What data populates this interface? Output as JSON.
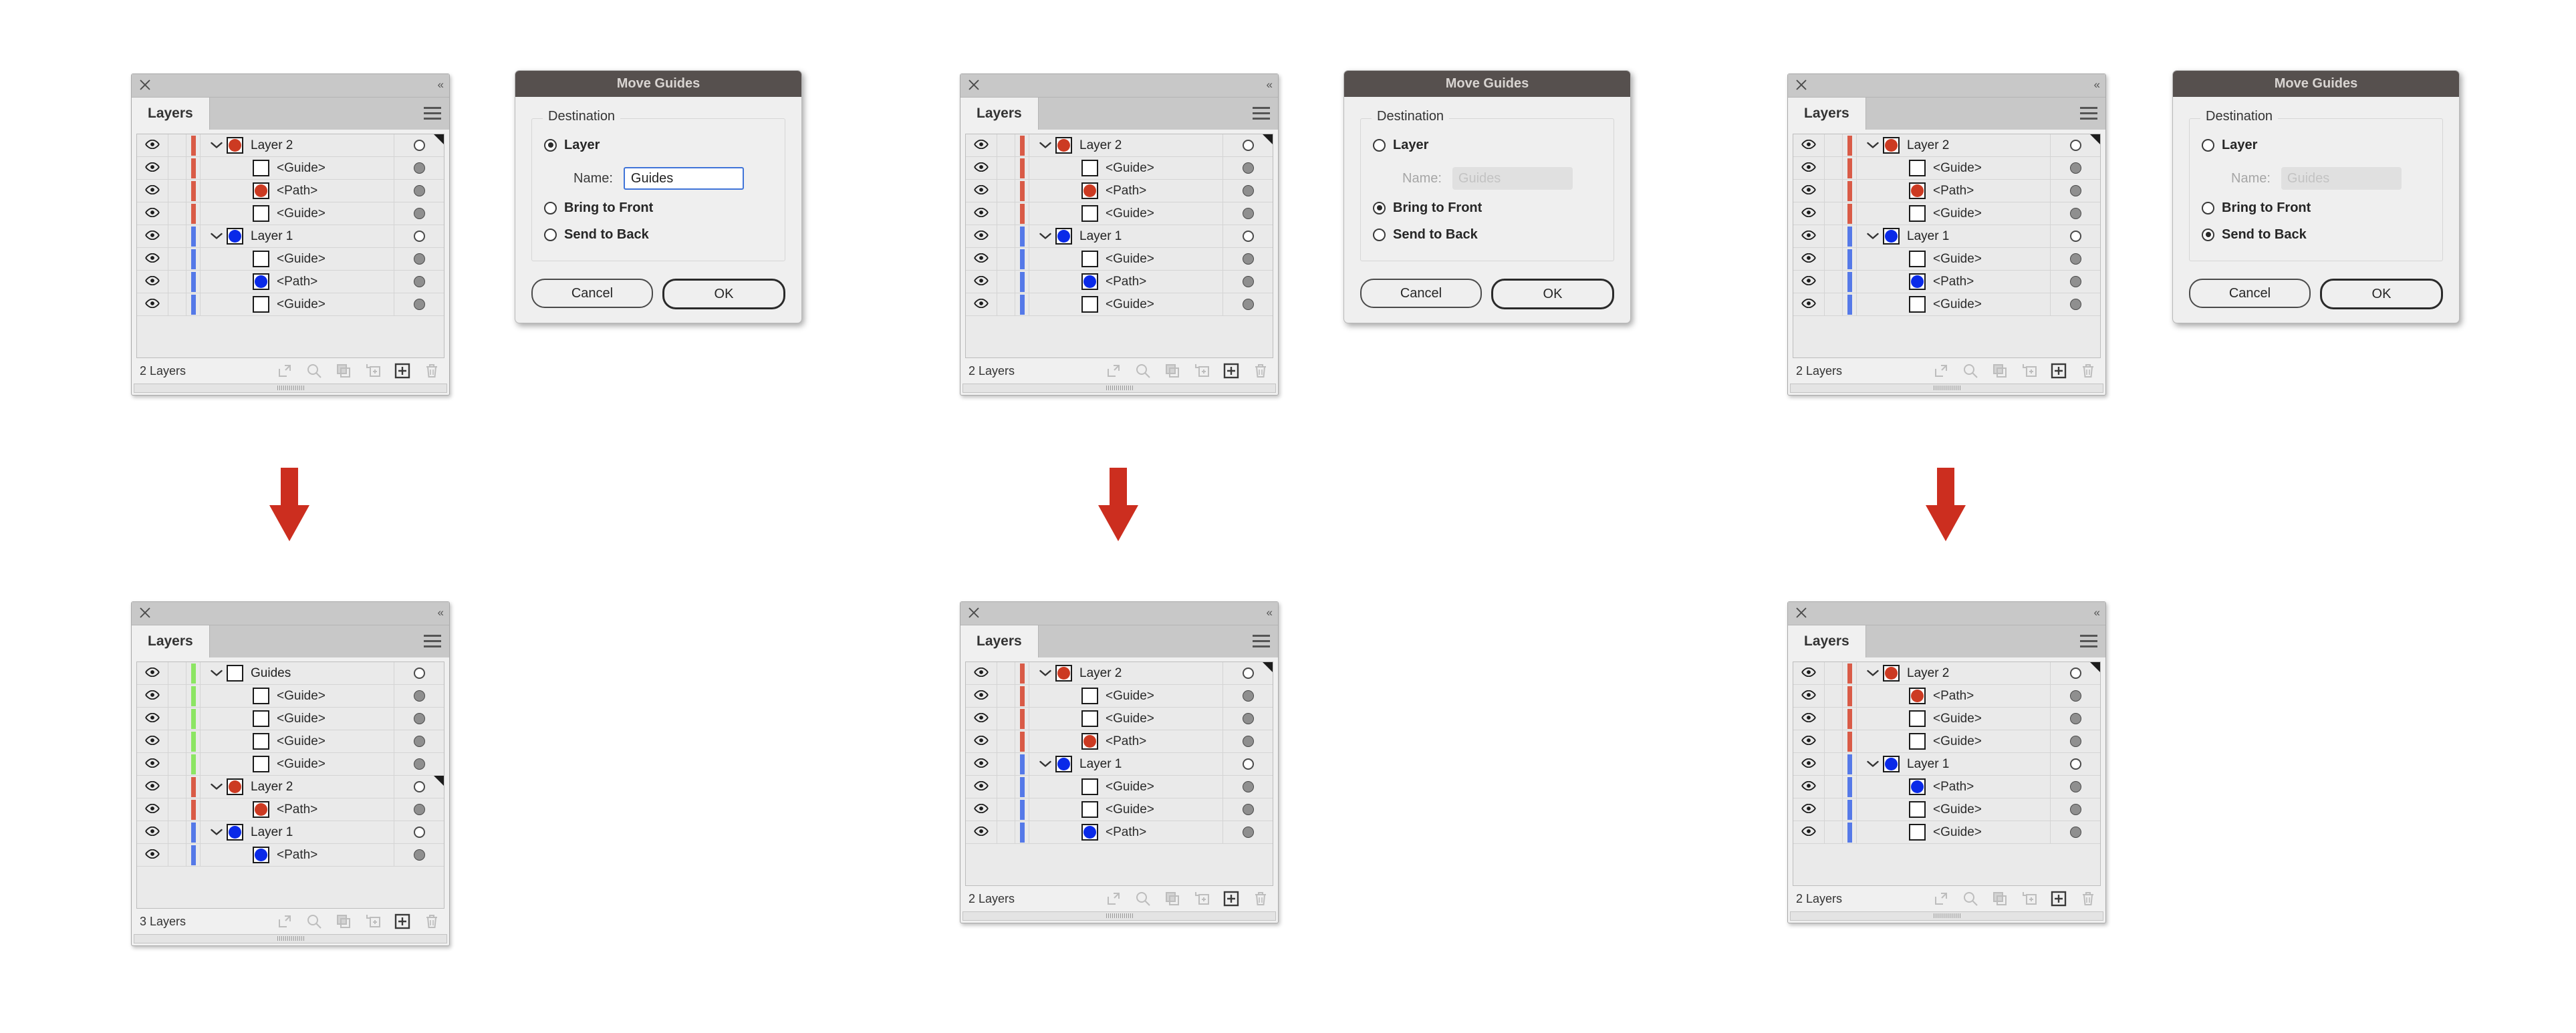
{
  "panel": {
    "tab_label": "Layers",
    "close_icon": "close-icon",
    "collapse_icon": "collapse-panel-icon",
    "menu_icon": "panel-menu-icon",
    "footer_icons": [
      "release-to-layers-icon",
      "locate-object-icon",
      "make-clipping-mask-icon",
      "create-new-sublayer-icon",
      "create-new-layer-icon",
      "delete-selection-icon"
    ]
  },
  "colors": {
    "red_layer": "#cc3a22",
    "blue_layer": "#0a2ae8",
    "red_bar": "#d95b47",
    "blue_bar": "#5579e8",
    "green_bar": "#8ce563",
    "arrow": "#cc2e1f",
    "dialog_titlebar": "#56504e",
    "focus_border": "#3f74d8"
  },
  "dialog": {
    "title": "Move Guides",
    "legend": "Destination",
    "option_layer": "Layer",
    "option_bring_front": "Bring to Front",
    "option_send_back": "Send to Back",
    "name_label": "Name:",
    "name_value": "Guides",
    "name_placeholder": "Guides",
    "cancel_label": "Cancel",
    "ok_label": "OK"
  },
  "columns": [
    {
      "id": "col-1",
      "dialog_selection": "layer",
      "before": {
        "count_label": "2 Layers",
        "rows": [
          {
            "label": "Layer 2",
            "kind": "layer",
            "swatch": "red",
            "bar": "red",
            "disclosure": true,
            "indent": false,
            "target": "hollow",
            "corner": true
          },
          {
            "label": "<Guide>",
            "kind": "guide",
            "swatch": "white",
            "bar": "red",
            "disclosure": false,
            "indent": true,
            "target": "filled",
            "corner": false
          },
          {
            "label": "<Path>",
            "kind": "path",
            "swatch": "red",
            "bar": "red",
            "disclosure": false,
            "indent": true,
            "target": "filled",
            "corner": false
          },
          {
            "label": "<Guide>",
            "kind": "guide",
            "swatch": "white",
            "bar": "red",
            "disclosure": false,
            "indent": true,
            "target": "filled",
            "corner": false
          },
          {
            "label": "Layer 1",
            "kind": "layer",
            "swatch": "blue",
            "bar": "blue",
            "disclosure": true,
            "indent": false,
            "target": "hollow",
            "corner": false
          },
          {
            "label": "<Guide>",
            "kind": "guide",
            "swatch": "white",
            "bar": "blue",
            "disclosure": false,
            "indent": true,
            "target": "filled",
            "corner": false
          },
          {
            "label": "<Path>",
            "kind": "path",
            "swatch": "blue",
            "bar": "blue",
            "disclosure": false,
            "indent": true,
            "target": "filled",
            "corner": false
          },
          {
            "label": "<Guide>",
            "kind": "guide",
            "swatch": "white",
            "bar": "blue",
            "disclosure": false,
            "indent": true,
            "target": "filled",
            "corner": false
          }
        ]
      },
      "after": {
        "count_label": "3 Layers",
        "rows": [
          {
            "label": "Guides",
            "kind": "layer",
            "swatch": "white",
            "bar": "green",
            "disclosure": true,
            "indent": false,
            "target": "hollow",
            "corner": false
          },
          {
            "label": "<Guide>",
            "kind": "guide",
            "swatch": "white",
            "bar": "green",
            "disclosure": false,
            "indent": true,
            "target": "filled",
            "corner": false
          },
          {
            "label": "<Guide>",
            "kind": "guide",
            "swatch": "white",
            "bar": "green",
            "disclosure": false,
            "indent": true,
            "target": "filled",
            "corner": false
          },
          {
            "label": "<Guide>",
            "kind": "guide",
            "swatch": "white",
            "bar": "green",
            "disclosure": false,
            "indent": true,
            "target": "filled",
            "corner": false
          },
          {
            "label": "<Guide>",
            "kind": "guide",
            "swatch": "white",
            "bar": "green",
            "disclosure": false,
            "indent": true,
            "target": "filled",
            "corner": false
          },
          {
            "label": "Layer 2",
            "kind": "layer",
            "swatch": "red",
            "bar": "red",
            "disclosure": true,
            "indent": false,
            "target": "hollow",
            "corner": true
          },
          {
            "label": "<Path>",
            "kind": "path",
            "swatch": "red",
            "bar": "red",
            "disclosure": false,
            "indent": true,
            "target": "filled",
            "corner": false
          },
          {
            "label": "Layer 1",
            "kind": "layer",
            "swatch": "blue",
            "bar": "blue",
            "disclosure": true,
            "indent": false,
            "target": "hollow",
            "corner": false
          },
          {
            "label": "<Path>",
            "kind": "path",
            "swatch": "blue",
            "bar": "blue",
            "disclosure": false,
            "indent": true,
            "target": "filled",
            "corner": false
          }
        ]
      }
    },
    {
      "id": "col-2",
      "dialog_selection": "bring_front",
      "before": {
        "count_label": "2 Layers",
        "rows": [
          {
            "label": "Layer 2",
            "kind": "layer",
            "swatch": "red",
            "bar": "red",
            "disclosure": true,
            "indent": false,
            "target": "hollow",
            "corner": true
          },
          {
            "label": "<Guide>",
            "kind": "guide",
            "swatch": "white",
            "bar": "red",
            "disclosure": false,
            "indent": true,
            "target": "filled",
            "corner": false
          },
          {
            "label": "<Path>",
            "kind": "path",
            "swatch": "red",
            "bar": "red",
            "disclosure": false,
            "indent": true,
            "target": "filled",
            "corner": false
          },
          {
            "label": "<Guide>",
            "kind": "guide",
            "swatch": "white",
            "bar": "red",
            "disclosure": false,
            "indent": true,
            "target": "filled",
            "corner": false
          },
          {
            "label": "Layer 1",
            "kind": "layer",
            "swatch": "blue",
            "bar": "blue",
            "disclosure": true,
            "indent": false,
            "target": "hollow",
            "corner": false
          },
          {
            "label": "<Guide>",
            "kind": "guide",
            "swatch": "white",
            "bar": "blue",
            "disclosure": false,
            "indent": true,
            "target": "filled",
            "corner": false
          },
          {
            "label": "<Path>",
            "kind": "path",
            "swatch": "blue",
            "bar": "blue",
            "disclosure": false,
            "indent": true,
            "target": "filled",
            "corner": false
          },
          {
            "label": "<Guide>",
            "kind": "guide",
            "swatch": "white",
            "bar": "blue",
            "disclosure": false,
            "indent": true,
            "target": "filled",
            "corner": false
          }
        ]
      },
      "after": {
        "count_label": "2 Layers",
        "rows": [
          {
            "label": "Layer 2",
            "kind": "layer",
            "swatch": "red",
            "bar": "red",
            "disclosure": true,
            "indent": false,
            "target": "hollow",
            "corner": true
          },
          {
            "label": "<Guide>",
            "kind": "guide",
            "swatch": "white",
            "bar": "red",
            "disclosure": false,
            "indent": true,
            "target": "filled",
            "corner": false
          },
          {
            "label": "<Guide>",
            "kind": "guide",
            "swatch": "white",
            "bar": "red",
            "disclosure": false,
            "indent": true,
            "target": "filled",
            "corner": false
          },
          {
            "label": "<Path>",
            "kind": "path",
            "swatch": "red",
            "bar": "red",
            "disclosure": false,
            "indent": true,
            "target": "filled",
            "corner": false
          },
          {
            "label": "Layer 1",
            "kind": "layer",
            "swatch": "blue",
            "bar": "blue",
            "disclosure": true,
            "indent": false,
            "target": "hollow",
            "corner": false
          },
          {
            "label": "<Guide>",
            "kind": "guide",
            "swatch": "white",
            "bar": "blue",
            "disclosure": false,
            "indent": true,
            "target": "filled",
            "corner": false
          },
          {
            "label": "<Guide>",
            "kind": "guide",
            "swatch": "white",
            "bar": "blue",
            "disclosure": false,
            "indent": true,
            "target": "filled",
            "corner": false
          },
          {
            "label": "<Path>",
            "kind": "path",
            "swatch": "blue",
            "bar": "blue",
            "disclosure": false,
            "indent": true,
            "target": "filled",
            "corner": false
          }
        ]
      }
    },
    {
      "id": "col-3",
      "dialog_selection": "send_back",
      "before": {
        "count_label": "2 Layers",
        "rows": [
          {
            "label": "Layer 2",
            "kind": "layer",
            "swatch": "red",
            "bar": "red",
            "disclosure": true,
            "indent": false,
            "target": "hollow",
            "corner": true
          },
          {
            "label": "<Guide>",
            "kind": "guide",
            "swatch": "white",
            "bar": "red",
            "disclosure": false,
            "indent": true,
            "target": "filled",
            "corner": false
          },
          {
            "label": "<Path>",
            "kind": "path",
            "swatch": "red",
            "bar": "red",
            "disclosure": false,
            "indent": true,
            "target": "filled",
            "corner": false
          },
          {
            "label": "<Guide>",
            "kind": "guide",
            "swatch": "white",
            "bar": "red",
            "disclosure": false,
            "indent": true,
            "target": "filled",
            "corner": false
          },
          {
            "label": "Layer 1",
            "kind": "layer",
            "swatch": "blue",
            "bar": "blue",
            "disclosure": true,
            "indent": false,
            "target": "hollow",
            "corner": false
          },
          {
            "label": "<Guide>",
            "kind": "guide",
            "swatch": "white",
            "bar": "blue",
            "disclosure": false,
            "indent": true,
            "target": "filled",
            "corner": false
          },
          {
            "label": "<Path>",
            "kind": "path",
            "swatch": "blue",
            "bar": "blue",
            "disclosure": false,
            "indent": true,
            "target": "filled",
            "corner": false
          },
          {
            "label": "<Guide>",
            "kind": "guide",
            "swatch": "white",
            "bar": "blue",
            "disclosure": false,
            "indent": true,
            "target": "filled",
            "corner": false
          }
        ]
      },
      "after": {
        "count_label": "2 Layers",
        "rows": [
          {
            "label": "Layer 2",
            "kind": "layer",
            "swatch": "red",
            "bar": "red",
            "disclosure": true,
            "indent": false,
            "target": "hollow",
            "corner": true
          },
          {
            "label": "<Path>",
            "kind": "path",
            "swatch": "red",
            "bar": "red",
            "disclosure": false,
            "indent": true,
            "target": "filled",
            "corner": false
          },
          {
            "label": "<Guide>",
            "kind": "guide",
            "swatch": "white",
            "bar": "red",
            "disclosure": false,
            "indent": true,
            "target": "filled",
            "corner": false
          },
          {
            "label": "<Guide>",
            "kind": "guide",
            "swatch": "white",
            "bar": "red",
            "disclosure": false,
            "indent": true,
            "target": "filled",
            "corner": false
          },
          {
            "label": "Layer 1",
            "kind": "layer",
            "swatch": "blue",
            "bar": "blue",
            "disclosure": true,
            "indent": false,
            "target": "hollow",
            "corner": false
          },
          {
            "label": "<Path>",
            "kind": "path",
            "swatch": "blue",
            "bar": "blue",
            "disclosure": false,
            "indent": true,
            "target": "filled",
            "corner": false
          },
          {
            "label": "<Guide>",
            "kind": "guide",
            "swatch": "white",
            "bar": "blue",
            "disclosure": false,
            "indent": true,
            "target": "filled",
            "corner": false
          },
          {
            "label": "<Guide>",
            "kind": "guide",
            "swatch": "white",
            "bar": "blue",
            "disclosure": false,
            "indent": true,
            "target": "filled",
            "corner": false
          }
        ]
      }
    }
  ]
}
